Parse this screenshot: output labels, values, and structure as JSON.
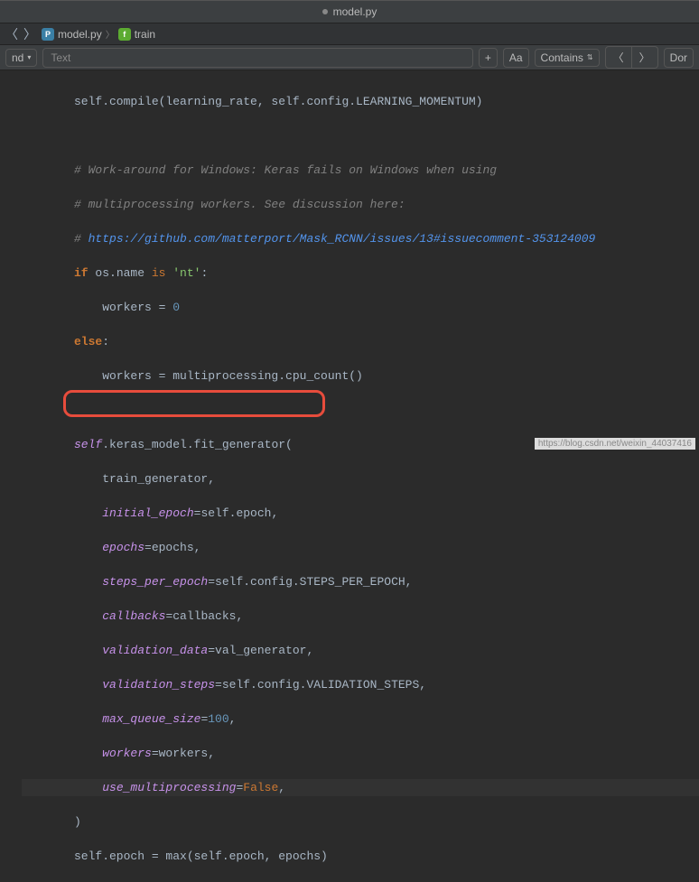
{
  "tab": {
    "filename": "model.py"
  },
  "breadcrumb": {
    "file": "model.py",
    "func": "train"
  },
  "findbar": {
    "mode": "nd",
    "placeholder": "Text",
    "plus": "+",
    "aa": "Aa",
    "contains": "Contains",
    "prev": "〈",
    "next": "〉",
    "done": "Dor"
  },
  "code": {
    "l1a": "self.compile(learning_rate, self.config.LEARNING_MOMENTUM)",
    "l2": "",
    "l3": "# Work-around for Windows: Keras fails on Windows when using",
    "l4": "# multiprocessing workers. See discussion here:",
    "l5a": "# ",
    "l5b": "https://github.com/matterport/Mask_RCNN/issues/13#issuecomment-353124009",
    "l6a": "if",
    "l6b": " os.name ",
    "l6c": "is",
    "l6d": " ",
    "l6e": "'nt'",
    "l6f": ":",
    "l7a": "    workers = ",
    "l7b": "0",
    "l8a": "else",
    "l8b": ":",
    "l9": "    workers = multiprocessing.cpu_count()",
    "l10": "",
    "l11a": "self",
    "l11b": ".keras_model.fit_generator(",
    "l12": "    train_generator,",
    "l13a": "    ",
    "l13b": "initial_epoch",
    "l13c": "=self.epoch,",
    "l14a": "    ",
    "l14b": "epochs",
    "l14c": "=epochs,",
    "l15a": "    ",
    "l15b": "steps_per_epoch",
    "l15c": "=self.config.STEPS_PER_EPOCH,",
    "l16a": "    ",
    "l16b": "callbacks",
    "l16c": "=callbacks,",
    "l17a": "    ",
    "l17b": "validation_data",
    "l17c": "=val_generator,",
    "l18a": "    ",
    "l18b": "validation_steps",
    "l18c": "=self.config.VALIDATION_STEPS,",
    "l19a": "    ",
    "l19b": "max_queue_size",
    "l19c": "=",
    "l19d": "100",
    "l19e": ",",
    "l20a": "    ",
    "l20b": "workers",
    "l20c": "=workers,",
    "l21a": "    ",
    "l21b": "use_multiprocessing",
    "l21c": "=",
    "l21d": "False",
    "l21e": ",",
    "l22": ")",
    "l23": "self.epoch = max(self.epoch, epochs)"
  },
  "watermark": "https://blog.csdn.net/weixin_44037416"
}
